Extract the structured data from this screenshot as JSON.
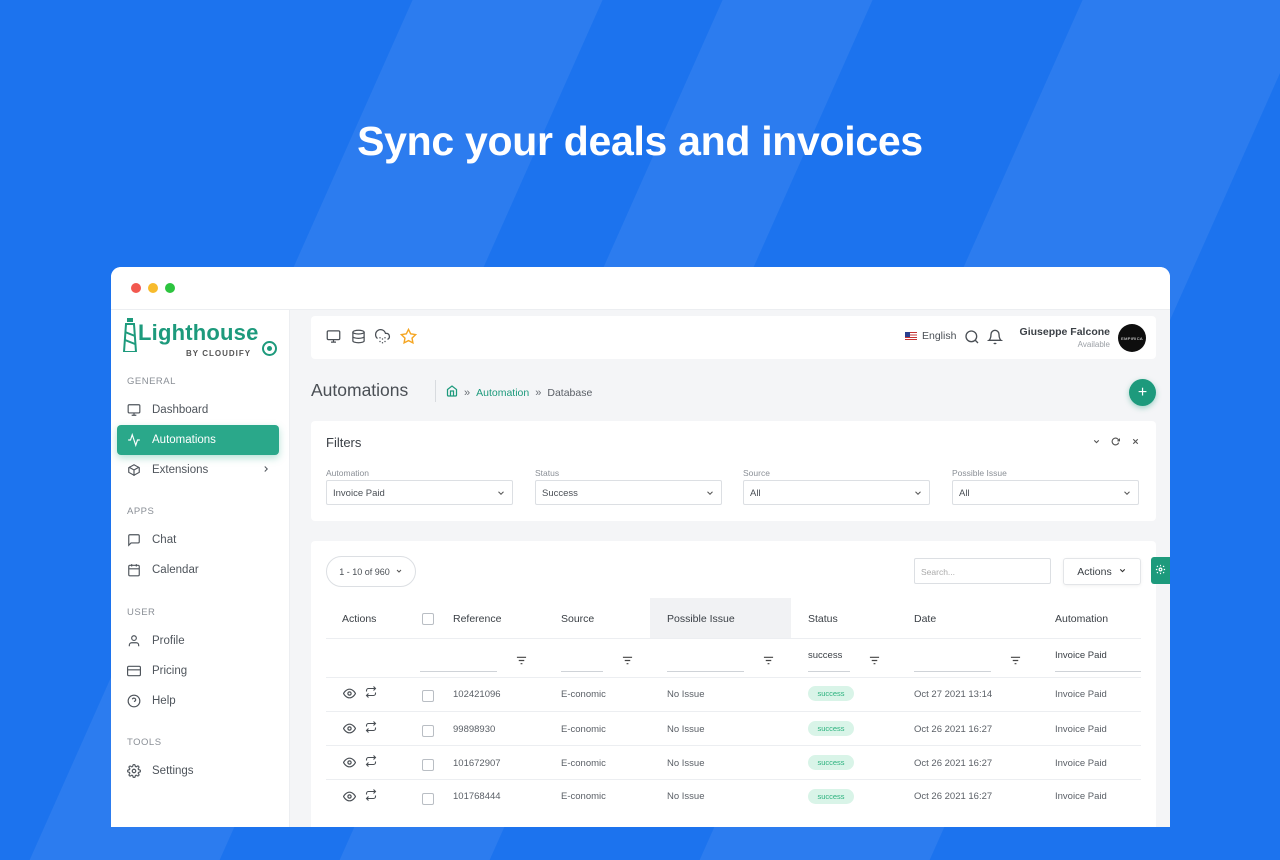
{
  "hero": {
    "title": "Sync your deals and invoices"
  },
  "brand": {
    "name": "Lighthouse",
    "tagline": "BY CLOUDIFY"
  },
  "sidebar": {
    "sections": [
      {
        "label": "GENERAL",
        "items": [
          {
            "label": "Dashboard",
            "icon": "monitor-icon"
          },
          {
            "label": "Automations",
            "icon": "activity-icon",
            "active": true
          },
          {
            "label": "Extensions",
            "icon": "box-icon",
            "has_children": true
          }
        ]
      },
      {
        "label": "APPS",
        "items": [
          {
            "label": "Chat",
            "icon": "chat-icon"
          },
          {
            "label": "Calendar",
            "icon": "calendar-icon"
          }
        ]
      },
      {
        "label": "USER",
        "items": [
          {
            "label": "Profile",
            "icon": "user-icon"
          },
          {
            "label": "Pricing",
            "icon": "credit-card-icon"
          },
          {
            "label": "Help",
            "icon": "help-circle-icon"
          }
        ]
      },
      {
        "label": "TOOLS",
        "items": [
          {
            "label": "Settings",
            "icon": "settings-icon"
          }
        ]
      }
    ]
  },
  "topbar": {
    "language": "English",
    "user": {
      "name": "Giuseppe Falcone",
      "status": "Available",
      "avatar_text": "EMPIRICA"
    },
    "icons": [
      "monitor-icon",
      "database-icon",
      "cloud-icon",
      "star-icon",
      "search-icon",
      "bell-icon"
    ],
    "accent": "#1d9a7c",
    "star_color": "#f5a623"
  },
  "page": {
    "title": "Automations",
    "breadcrumb": {
      "link": "Automation",
      "current": "Database"
    }
  },
  "filters": {
    "title": "Filters",
    "fields": [
      {
        "label": "Automation",
        "value": "Invoice Paid"
      },
      {
        "label": "Status",
        "value": "Success"
      },
      {
        "label": "Source",
        "value": "All"
      },
      {
        "label": "Possible Issue",
        "value": "All"
      }
    ]
  },
  "table": {
    "pager": "1 - 10 of 960",
    "search_placeholder": "Search...",
    "actions_label": "Actions",
    "columns": [
      "Actions",
      "Reference",
      "Source",
      "Possible Issue",
      "Status",
      "Date",
      "Automation"
    ],
    "column_filters": {
      "status": "success",
      "automation": "Invoice Paid"
    },
    "rows": [
      {
        "reference": "102421096",
        "source": "E-conomic",
        "issue": "No Issue",
        "status": "success",
        "date": "Oct 27 2021 13:14",
        "automation": "Invoice Paid"
      },
      {
        "reference": "99898930",
        "source": "E-conomic",
        "issue": "No Issue",
        "status": "success",
        "date": "Oct 26 2021 16:27",
        "automation": "Invoice Paid"
      },
      {
        "reference": "101672907",
        "source": "E-conomic",
        "issue": "No Issue",
        "status": "success",
        "date": "Oct 26 2021 16:27",
        "automation": "Invoice Paid"
      },
      {
        "reference": "101768444",
        "source": "E-conomic",
        "issue": "No Issue",
        "status": "success",
        "date": "Oct 26 2021 16:27",
        "automation": "Invoice Paid"
      }
    ]
  }
}
